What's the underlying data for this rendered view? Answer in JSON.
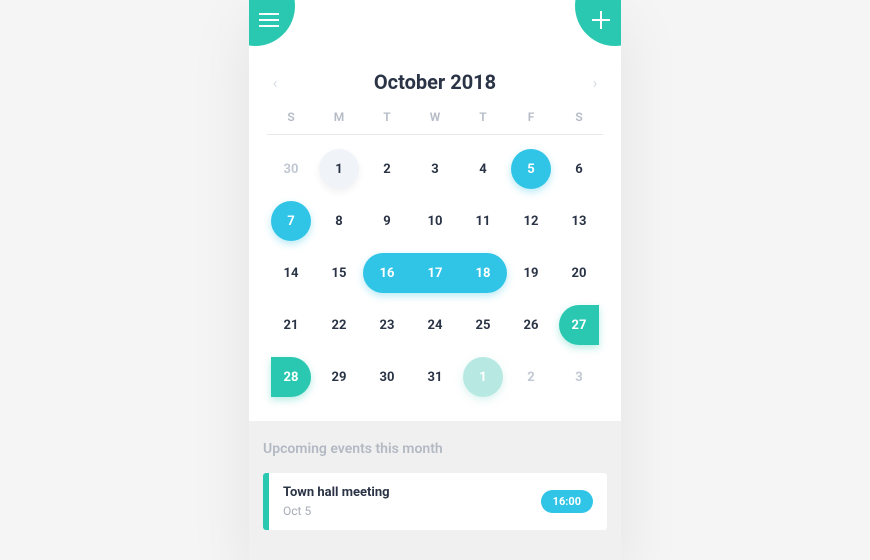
{
  "header": {
    "monthLabel": "October 2018"
  },
  "dow": [
    "S",
    "M",
    "T",
    "W",
    "T",
    "F",
    "S"
  ],
  "dates": [
    {
      "n": "30",
      "cls": "muted"
    },
    {
      "n": "1",
      "cls": "today"
    },
    {
      "n": "2",
      "cls": ""
    },
    {
      "n": "3",
      "cls": ""
    },
    {
      "n": "4",
      "cls": ""
    },
    {
      "n": "5",
      "cls": "dot-teal"
    },
    {
      "n": "6",
      "cls": ""
    },
    {
      "n": "7",
      "cls": "dot-teal"
    },
    {
      "n": "8",
      "cls": ""
    },
    {
      "n": "9",
      "cls": ""
    },
    {
      "n": "10",
      "cls": ""
    },
    {
      "n": "11",
      "cls": ""
    },
    {
      "n": "12",
      "cls": ""
    },
    {
      "n": "13",
      "cls": ""
    },
    {
      "n": "14",
      "cls": ""
    },
    {
      "n": "15",
      "cls": ""
    },
    {
      "range": [
        "16",
        "17",
        "18"
      ]
    },
    {
      "n": "19",
      "cls": ""
    },
    {
      "n": "20",
      "cls": ""
    },
    {
      "n": "21",
      "cls": ""
    },
    {
      "n": "22",
      "cls": ""
    },
    {
      "n": "23",
      "cls": ""
    },
    {
      "n": "24",
      "cls": ""
    },
    {
      "n": "25",
      "cls": ""
    },
    {
      "n": "26",
      "cls": ""
    },
    {
      "n": "27",
      "cls": "dot-green-r"
    },
    {
      "n": "28",
      "cls": "dot-green-l"
    },
    {
      "n": "29",
      "cls": ""
    },
    {
      "n": "30",
      "cls": ""
    },
    {
      "n": "31",
      "cls": ""
    },
    {
      "n": "1",
      "cls": "muted dot-mint"
    },
    {
      "n": "2",
      "cls": "muted"
    },
    {
      "n": "3",
      "cls": "muted"
    }
  ],
  "events": {
    "heading": "Upcoming events this month",
    "items": [
      {
        "title": "Town hall meeting",
        "date": "Oct 5",
        "time": "16:00"
      }
    ]
  }
}
